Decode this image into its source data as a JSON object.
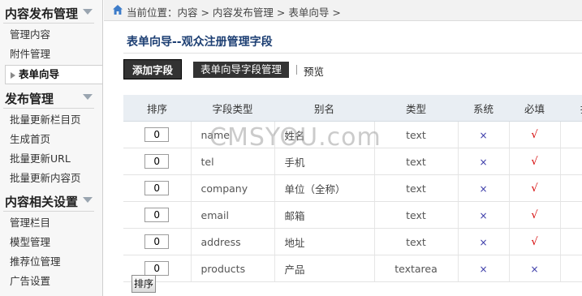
{
  "sidebar": {
    "groups": [
      {
        "title": "内容发布管理",
        "items": [
          "管理内容",
          "附件管理",
          "表单向导"
        ],
        "active": 2
      },
      {
        "title": "发布管理",
        "items": [
          "批量更新栏目页",
          "生成首页",
          "批量更新URL",
          "批量更新内容页"
        ]
      },
      {
        "title": "内容相关设置",
        "items": [
          "管理栏目",
          "模型管理",
          "推荐位管理",
          "广告设置"
        ]
      }
    ]
  },
  "breadcrumb": "当前位置：内容 > 内容发布管理 > 表单向导 >",
  "page_title": "表单向导--观众注册管理字段",
  "toolbar": {
    "add": "添加字段",
    "manage": "表单向导字段管理",
    "preview": "预览"
  },
  "table": {
    "headers": [
      "排序",
      "字段类型",
      "别名",
      "类型",
      "系统",
      "必填",
      "排"
    ],
    "rows": [
      {
        "order": "0",
        "field": "name",
        "alias": "姓名",
        "type": "text",
        "system": "×",
        "required": "√"
      },
      {
        "order": "0",
        "field": "tel",
        "alias": "手机",
        "type": "text",
        "system": "×",
        "required": "√"
      },
      {
        "order": "0",
        "field": "company",
        "alias": "单位（全称）",
        "type": "text",
        "system": "×",
        "required": "√"
      },
      {
        "order": "0",
        "field": "email",
        "alias": "邮箱",
        "type": "text",
        "system": "×",
        "required": "√"
      },
      {
        "order": "0",
        "field": "address",
        "alias": "地址",
        "type": "text",
        "system": "×",
        "required": "√"
      },
      {
        "order": "0",
        "field": "products",
        "alias": "产品",
        "type": "textarea",
        "system": "×",
        "required": "×"
      }
    ]
  },
  "sort_button": "排序",
  "watermark": "CMSYOU.com",
  "colors": {
    "title": "#1d3f73",
    "check": "#d40000",
    "cross": "#3a3aa8",
    "header_bg": "#e9eef3"
  },
  "icons": {
    "home": "home-icon",
    "group_toggle": "chevron-down-icon"
  }
}
